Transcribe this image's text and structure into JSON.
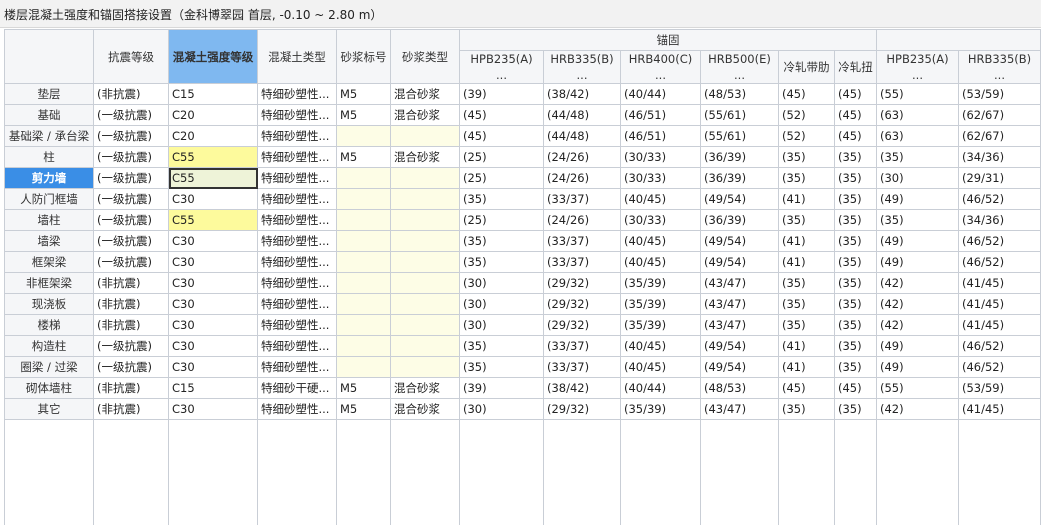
{
  "window": {
    "title": "楼层混凝土强度和锚固搭接设置（金科博翠园  首层, -0.10 ~ 2.80 m）"
  },
  "colors": {
    "selected_header": "#7fb8f0",
    "selected_row": "#3a8ee6",
    "highlight": "#fdfa9c",
    "empty_cell": "#fdfde6"
  },
  "headers": {
    "seismic": "抗震等级",
    "concrete_grade": "混凝土强度等级",
    "concrete_type": "混凝土类型",
    "mortar_grade": "砂浆标号",
    "mortar_type": "砂浆类型",
    "anchor_group": "锚固",
    "anchor": [
      "HPB235(A)\n...",
      "HRB335(B)\n...",
      "HRB400(C)\n...",
      "HRB500(E)\n...",
      "冷轧带肋",
      "冷轧扭"
    ],
    "lap": [
      "HPB235(A)\n...",
      "HRB335(B)\n..."
    ]
  },
  "rows": [
    {
      "name": "垫层",
      "seismic": "(非抗震)",
      "grade": "C15",
      "type": "特细砂塑性...",
      "mortar_grade": "M5",
      "mortar_type": "混合砂浆",
      "anchor": [
        "(39)",
        "(38/42)",
        "(40/44)",
        "(48/53)",
        "(45)",
        "(45)"
      ],
      "lap": [
        "(55)",
        "(53/59)"
      ]
    },
    {
      "name": "基础",
      "seismic": "(一级抗震)",
      "grade": "C20",
      "type": "特细砂塑性...",
      "mortar_grade": "M5",
      "mortar_type": "混合砂浆",
      "anchor": [
        "(45)",
        "(44/48)",
        "(46/51)",
        "(55/61)",
        "(52)",
        "(45)"
      ],
      "lap": [
        "(63)",
        "(62/67)"
      ]
    },
    {
      "name": "基础梁 / 承台梁",
      "seismic": "(一级抗震)",
      "grade": "C20",
      "type": "特细砂塑性...",
      "mortar_grade": "",
      "mortar_type": "",
      "anchor": [
        "(45)",
        "(44/48)",
        "(46/51)",
        "(55/61)",
        "(52)",
        "(45)"
      ],
      "lap": [
        "(63)",
        "(62/67)"
      ]
    },
    {
      "name": "柱",
      "seismic": "(一级抗震)",
      "grade": "C55",
      "type": "特细砂塑性...",
      "mortar_grade": "M5",
      "mortar_type": "混合砂浆",
      "anchor": [
        "(25)",
        "(24/26)",
        "(30/33)",
        "(36/39)",
        "(35)",
        "(35)"
      ],
      "lap": [
        "(35)",
        "(34/36)"
      ]
    },
    {
      "name": "剪力墙",
      "seismic": "(一级抗震)",
      "grade": "C55",
      "type": "特细砂塑性...",
      "mortar_grade": "",
      "mortar_type": "",
      "anchor": [
        "(25)",
        "(24/26)",
        "(30/33)",
        "(36/39)",
        "(35)",
        "(35)"
      ],
      "lap": [
        "(30)",
        "(29/31)"
      ]
    },
    {
      "name": "人防门框墙",
      "seismic": "(一级抗震)",
      "grade": "C30",
      "type": "特细砂塑性...",
      "mortar_grade": "",
      "mortar_type": "",
      "anchor": [
        "(35)",
        "(33/37)",
        "(40/45)",
        "(49/54)",
        "(41)",
        "(35)"
      ],
      "lap": [
        "(49)",
        "(46/52)"
      ]
    },
    {
      "name": "墙柱",
      "seismic": "(一级抗震)",
      "grade": "C55",
      "type": "特细砂塑性...",
      "mortar_grade": "",
      "mortar_type": "",
      "anchor": [
        "(25)",
        "(24/26)",
        "(30/33)",
        "(36/39)",
        "(35)",
        "(35)"
      ],
      "lap": [
        "(35)",
        "(34/36)"
      ]
    },
    {
      "name": "墙梁",
      "seismic": "(一级抗震)",
      "grade": "C30",
      "type": "特细砂塑性...",
      "mortar_grade": "",
      "mortar_type": "",
      "anchor": [
        "(35)",
        "(33/37)",
        "(40/45)",
        "(49/54)",
        "(41)",
        "(35)"
      ],
      "lap": [
        "(49)",
        "(46/52)"
      ]
    },
    {
      "name": "框架梁",
      "seismic": "(一级抗震)",
      "grade": "C30",
      "type": "特细砂塑性...",
      "mortar_grade": "",
      "mortar_type": "",
      "anchor": [
        "(35)",
        "(33/37)",
        "(40/45)",
        "(49/54)",
        "(41)",
        "(35)"
      ],
      "lap": [
        "(49)",
        "(46/52)"
      ]
    },
    {
      "name": "非框架梁",
      "seismic": "(非抗震)",
      "grade": "C30",
      "type": "特细砂塑性...",
      "mortar_grade": "",
      "mortar_type": "",
      "anchor": [
        "(30)",
        "(29/32)",
        "(35/39)",
        "(43/47)",
        "(35)",
        "(35)"
      ],
      "lap": [
        "(42)",
        "(41/45)"
      ]
    },
    {
      "name": "现浇板",
      "seismic": "(非抗震)",
      "grade": "C30",
      "type": "特细砂塑性...",
      "mortar_grade": "",
      "mortar_type": "",
      "anchor": [
        "(30)",
        "(29/32)",
        "(35/39)",
        "(43/47)",
        "(35)",
        "(35)"
      ],
      "lap": [
        "(42)",
        "(41/45)"
      ]
    },
    {
      "name": "楼梯",
      "seismic": "(非抗震)",
      "grade": "C30",
      "type": "特细砂塑性...",
      "mortar_grade": "",
      "mortar_type": "",
      "anchor": [
        "(30)",
        "(29/32)",
        "(35/39)",
        "(43/47)",
        "(35)",
        "(35)"
      ],
      "lap": [
        "(42)",
        "(41/45)"
      ]
    },
    {
      "name": "构造柱",
      "seismic": "(一级抗震)",
      "grade": "C30",
      "type": "特细砂塑性...",
      "mortar_grade": "",
      "mortar_type": "",
      "anchor": [
        "(35)",
        "(33/37)",
        "(40/45)",
        "(49/54)",
        "(41)",
        "(35)"
      ],
      "lap": [
        "(49)",
        "(46/52)"
      ]
    },
    {
      "name": "圈梁 / 过梁",
      "seismic": "(一级抗震)",
      "grade": "C30",
      "type": "特细砂塑性...",
      "mortar_grade": "",
      "mortar_type": "",
      "anchor": [
        "(35)",
        "(33/37)",
        "(40/45)",
        "(49/54)",
        "(41)",
        "(35)"
      ],
      "lap": [
        "(49)",
        "(46/52)"
      ]
    },
    {
      "name": "砌体墙柱",
      "seismic": "(非抗震)",
      "grade": "C15",
      "type": "特细砂干硬...",
      "mortar_grade": "M5",
      "mortar_type": "混合砂浆",
      "anchor": [
        "(39)",
        "(38/42)",
        "(40/44)",
        "(48/53)",
        "(45)",
        "(45)"
      ],
      "lap": [
        "(55)",
        "(53/59)"
      ]
    },
    {
      "name": "其它",
      "seismic": "(非抗震)",
      "grade": "C30",
      "type": "特细砂塑性...",
      "mortar_grade": "M5",
      "mortar_type": "混合砂浆",
      "anchor": [
        "(30)",
        "(29/32)",
        "(35/39)",
        "(43/47)",
        "(35)",
        "(35)"
      ],
      "lap": [
        "(42)",
        "(41/45)"
      ]
    }
  ],
  "state": {
    "selected_row": "剪力墙",
    "selected_column": "混凝土强度等级",
    "highlighted_grade_rows": [
      "柱",
      "剪力墙",
      "墙柱"
    ]
  }
}
